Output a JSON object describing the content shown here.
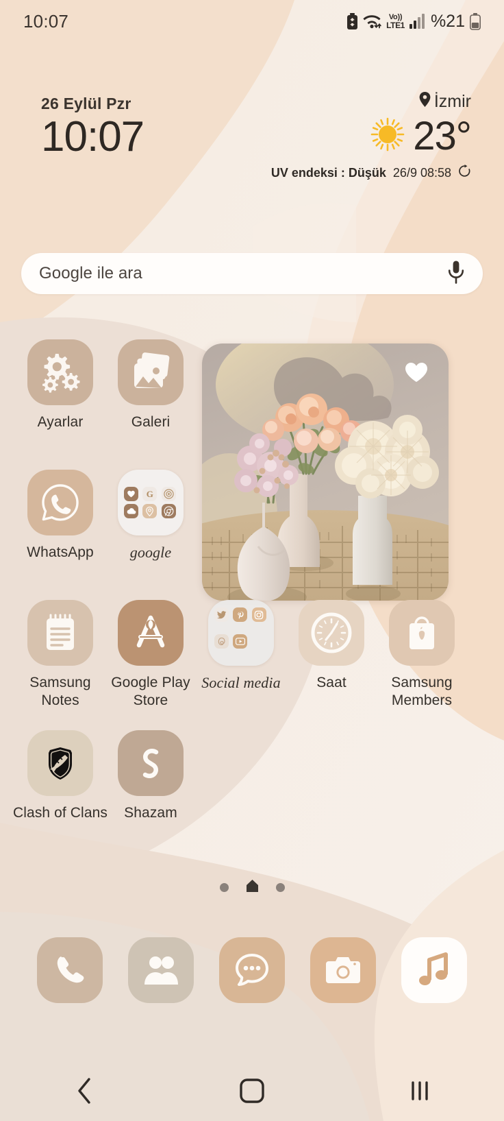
{
  "status_bar": {
    "time": "10:07",
    "network_label": "Vo)) LTE1",
    "network_top": "Vo))",
    "network_bottom": "LTE1",
    "battery_percent": "%21",
    "icons": [
      "battery-saver-icon",
      "wifi-icon",
      "volte-icon",
      "signal-icon",
      "battery-icon"
    ]
  },
  "widget": {
    "date": "26 Eylül Pzr",
    "time": "10:07",
    "location": "İzmir",
    "temperature": "23°",
    "condition_icon": "sun-icon",
    "uv_index": "UV endeksi : Düşük",
    "updated": "26/9 08:58",
    "refresh_icon": "refresh-icon"
  },
  "search": {
    "placeholder": "Google ile ara",
    "mic_icon": "microphone-icon"
  },
  "apps": {
    "row1": [
      {
        "label": "Ayarlar",
        "icon": "settings-gears-icon",
        "bg": "#cbb29c",
        "type": "app"
      },
      {
        "label": "Galeri",
        "icon": "gallery-photos-icon",
        "bg": "#cbb29c",
        "type": "app"
      }
    ],
    "row2": [
      {
        "label": "WhatsApp",
        "icon": "whatsapp-icon",
        "bg": "#d5b79c",
        "type": "app"
      },
      {
        "label": "google",
        "icon": "folder-icon",
        "bg": "#f3f1f0",
        "type": "folder",
        "mini_icons": [
          "google-photos-icon",
          "google-search-icon",
          "google-podcasts-icon",
          "google-drive-icon",
          "google-maps-icon",
          "chrome-icon"
        ]
      }
    ],
    "row3": [
      {
        "label": "Samsung Notes",
        "icon": "notes-icon",
        "bg": "#d7c2ae",
        "type": "app"
      },
      {
        "label": "Google Play Store",
        "icon": "play-store-icon",
        "bg": "#bb9372",
        "type": "app"
      },
      {
        "label": "Social media",
        "icon": "folder-icon",
        "bg": "#eceae9",
        "type": "folder",
        "mini_icons": [
          "twitter-icon",
          "pinterest-icon",
          "instagram-icon",
          "threads-icon",
          "youtube-icon"
        ]
      },
      {
        "label": "Saat",
        "icon": "clock-icon",
        "bg": "#e6d4c2",
        "type": "app"
      },
      {
        "label": "Samsung Members",
        "icon": "shopping-bag-apple-icon",
        "bg": "#e0c8b2",
        "type": "app"
      }
    ],
    "row4": [
      {
        "label": "Clash of Clans",
        "icon": "clash-shield-icon",
        "bg": "#ddd0bd",
        "type": "app"
      },
      {
        "label": "Shazam",
        "icon": "shazam-icon",
        "bg": "#bfa894",
        "type": "app"
      }
    ]
  },
  "photo_widget": {
    "name": "photo-widget",
    "alt": "Three ceramic vases with peach roses, pink chrysanthemums and cream dahlias on a woven table",
    "favorite_icon": "heart-icon"
  },
  "page_indicator": {
    "pages": 3,
    "current": 2,
    "home_icon": "home-page-icon"
  },
  "dock": [
    {
      "label": "Phone",
      "icon": "phone-icon",
      "bg": "#cdb7a2",
      "fg": "#ffffff"
    },
    {
      "label": "Contacts",
      "icon": "contacts-icon",
      "bg": "#cec3b4",
      "fg": "#ffffff"
    },
    {
      "label": "Messages",
      "icon": "messages-icon",
      "bg": "#d8b695",
      "fg": "#ffffff"
    },
    {
      "label": "Camera",
      "icon": "camera-icon",
      "bg": "#ddb692",
      "fg": "#ffffff"
    },
    {
      "label": "Music",
      "icon": "music-note-icon",
      "bg": "#fffdfb",
      "fg": "#d6a87e"
    }
  ],
  "nav_bar": {
    "back": "back-icon",
    "home": "home-icon",
    "recents": "recents-icon"
  },
  "colors": {
    "wallpaper_light": "#f7efe7",
    "wallpaper_peach": "#f2dcc8",
    "wallpaper_blush": "#e9ddd3",
    "wallpaper_tan": "#ecd8c4",
    "text_primary": "#322d28",
    "accent_tan": "#cbb29c",
    "sun_yellow": "#f5b82e"
  }
}
